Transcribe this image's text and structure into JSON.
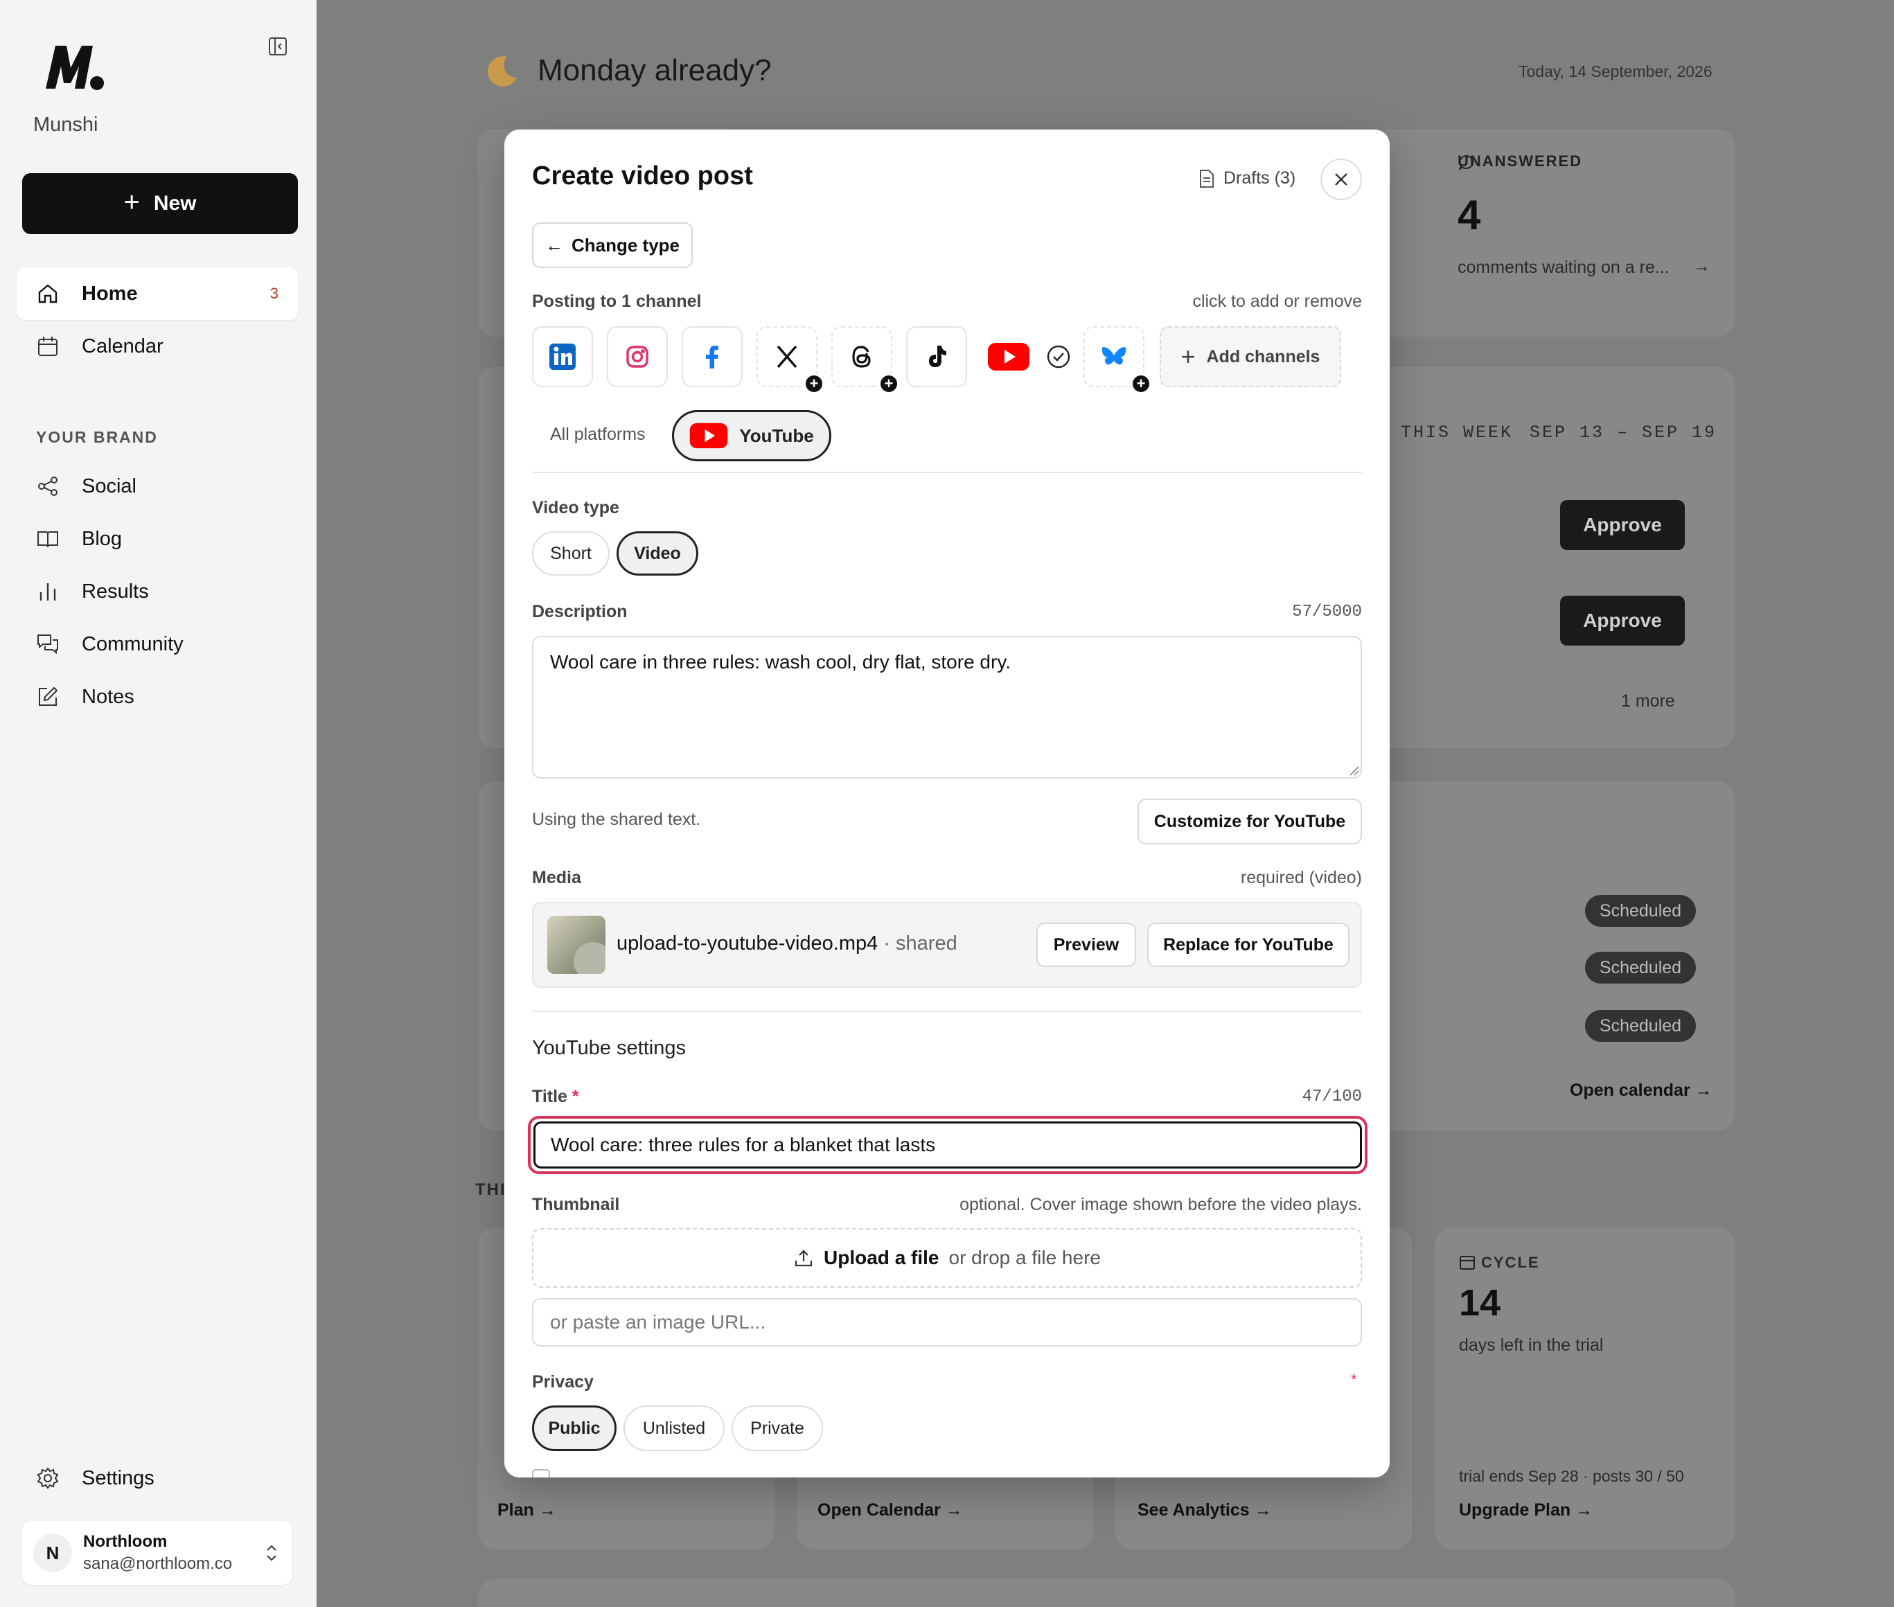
{
  "sidebar": {
    "brand": "Munshi",
    "new_label": "New",
    "nav": [
      {
        "label": "Home",
        "badge": "3"
      },
      {
        "label": "Calendar"
      }
    ],
    "section_label": "YOUR BRAND",
    "brand_nav": [
      {
        "label": "Social"
      },
      {
        "label": "Blog"
      },
      {
        "label": "Results"
      },
      {
        "label": "Community"
      },
      {
        "label": "Notes"
      }
    ],
    "settings_label": "Settings",
    "user": {
      "initial": "N",
      "name": "Northloom",
      "email": "sana@northloom.co"
    }
  },
  "background": {
    "greeting": "Monday already?",
    "today": "Today, 14 September, 2026",
    "unanswered": {
      "label": "UNANSWERED",
      "count": "4",
      "text": "comments waiting on a re..."
    },
    "week": {
      "label": "THIS WEEK",
      "range": "SEP 13 – SEP 19",
      "approve_label": "Approve",
      "more": "1 more"
    },
    "scheduled_label": "Scheduled",
    "open_calendar_link": "Open calendar →",
    "cycle": {
      "label": "CYCLE",
      "count": "14",
      "text": "days left in the trial",
      "footer": "trial ends Sep 28 · posts 30 / 50",
      "link": "Upgrade Plan →"
    },
    "links": [
      "Plan →",
      "Open Calendar →",
      "See Analytics →"
    ],
    "partial_heading": "THI"
  },
  "modal": {
    "title": "Create video post",
    "drafts": "Drafts (3)",
    "change_type": "Change type",
    "posting_label": "Posting to 1 channel",
    "posting_hint": "click to add or remove",
    "channels": [
      "linkedin-icon",
      "instagram-icon",
      "facebook-icon",
      "x-icon",
      "threads-icon",
      "tiktok-icon",
      "youtube-icon",
      "bluesky-icon"
    ],
    "add_channels": "Add channels",
    "tab_all": "All platforms",
    "tab_youtube": "YouTube",
    "video_type_label": "Video type",
    "video_types": [
      "Short",
      "Video"
    ],
    "video_type_selected": "Video",
    "description_label": "Description",
    "description_counter": "57/5000",
    "description_value": "Wool care in three rules: wash cool, dry flat, store dry.",
    "shared_hint": "Using the shared text.",
    "customize_label": "Customize for YouTube",
    "media_label": "Media",
    "media_hint": "required (video)",
    "file_name": "upload-to-youtube-video.mp4",
    "file_tag": "· shared",
    "preview_label": "Preview",
    "replace_label": "Replace for YouTube",
    "settings_heading": "YouTube settings",
    "title_label": "Title",
    "required_mark": "*",
    "title_counter": "47/100",
    "title_value": "Wool care: three rules for a blanket that lasts",
    "thumbnail_label": "Thumbnail",
    "thumbnail_hint": "optional. Cover image shown before the video plays.",
    "upload_label": "Upload a file",
    "upload_hint": "or drop a file here",
    "url_placeholder": "or paste an image URL...",
    "privacy_label": "Privacy",
    "privacy_options": [
      "Public",
      "Unlisted",
      "Private"
    ],
    "privacy_selected": "Public"
  },
  "colors": {
    "accent_red": "#d6345c",
    "youtube_red": "#ff0000",
    "linkedin_blue": "#0a66c2",
    "facebook_blue": "#1877f2",
    "bluesky_blue": "#1185fe"
  }
}
